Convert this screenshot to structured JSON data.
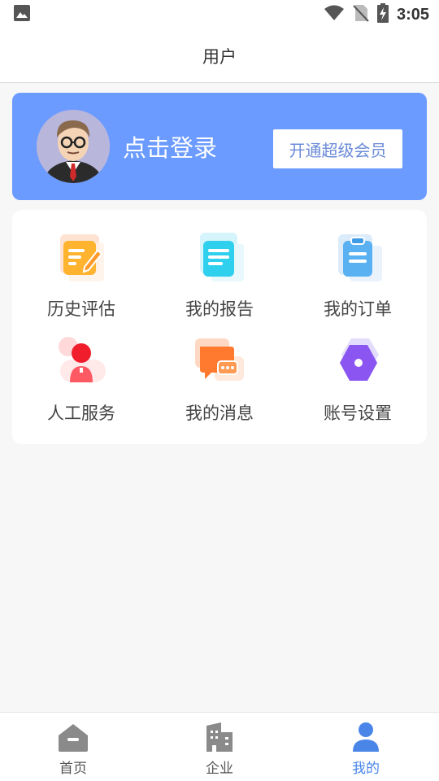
{
  "status_bar": {
    "time": "3:05"
  },
  "header": {
    "title": "用户"
  },
  "profile": {
    "login_text": "点击登录",
    "vip_button_label": "开通超级会员"
  },
  "menu": [
    {
      "label": "历史评估",
      "icon": "history-assessment-icon"
    },
    {
      "label": "我的报告",
      "icon": "report-icon"
    },
    {
      "label": "我的订单",
      "icon": "order-clipboard-icon"
    },
    {
      "label": "人工服务",
      "icon": "customer-service-icon"
    },
    {
      "label": "我的消息",
      "icon": "message-icon"
    },
    {
      "label": "账号设置",
      "icon": "account-settings-icon"
    }
  ],
  "tabs": [
    {
      "label": "首页",
      "icon": "home-icon",
      "active": false
    },
    {
      "label": "企业",
      "icon": "building-icon",
      "active": false
    },
    {
      "label": "我的",
      "icon": "user-icon",
      "active": true
    }
  ],
  "colors": {
    "accent": "#6b9bff",
    "active_tab": "#4a86e8",
    "background": "#f7f7f8"
  }
}
